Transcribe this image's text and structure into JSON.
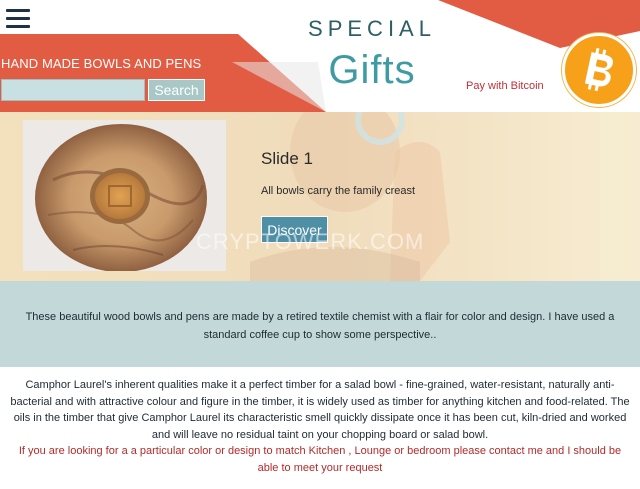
{
  "header": {
    "menu_icon": "hamburger-menu-icon",
    "tagline": "HAND MADE BOWLS AND PENS",
    "search": {
      "placeholder": "",
      "button_label": "Search"
    },
    "brand_top": "SPECIAL",
    "brand_main": "Gifts",
    "pay_link": "Pay with Bitcoin",
    "bitcoin_icon": "bitcoin-logo-icon",
    "colors": {
      "accent": "#e25b43",
      "teal": "#3e9ba3",
      "bitcoin": "#f7a11a"
    }
  },
  "slider": {
    "title": "Slide 1",
    "text": "All bowls carry the family creast",
    "button_label": "Discover",
    "watermark": "CRYPTOWERK.COM"
  },
  "intro": {
    "text": "These beautiful wood bowls and pens are made by a retired textile chemist  with a flair for color and design.  I have used a standard coffee cup to show some perspective.."
  },
  "info": {
    "paragraph": "Camphor Laurel's inherent qualities make it a perfect timber for a salad bowl - fine-grained, water-resistant, naturally anti-bacterial and with attractive colour and figure in the timber, it is widely used as timber for anything kitchen and food-related. The oils in the timber that give Camphor Laurel its characteristic smell quickly dissipate once it has been cut, kiln-dried and worked and will leave no residual taint on your chopping board or salad bowl.",
    "cta": "If you are looking for a a particular color or design to match Kitchen , Lounge  or bedroom please  contact me and I should be able to meet your request"
  }
}
